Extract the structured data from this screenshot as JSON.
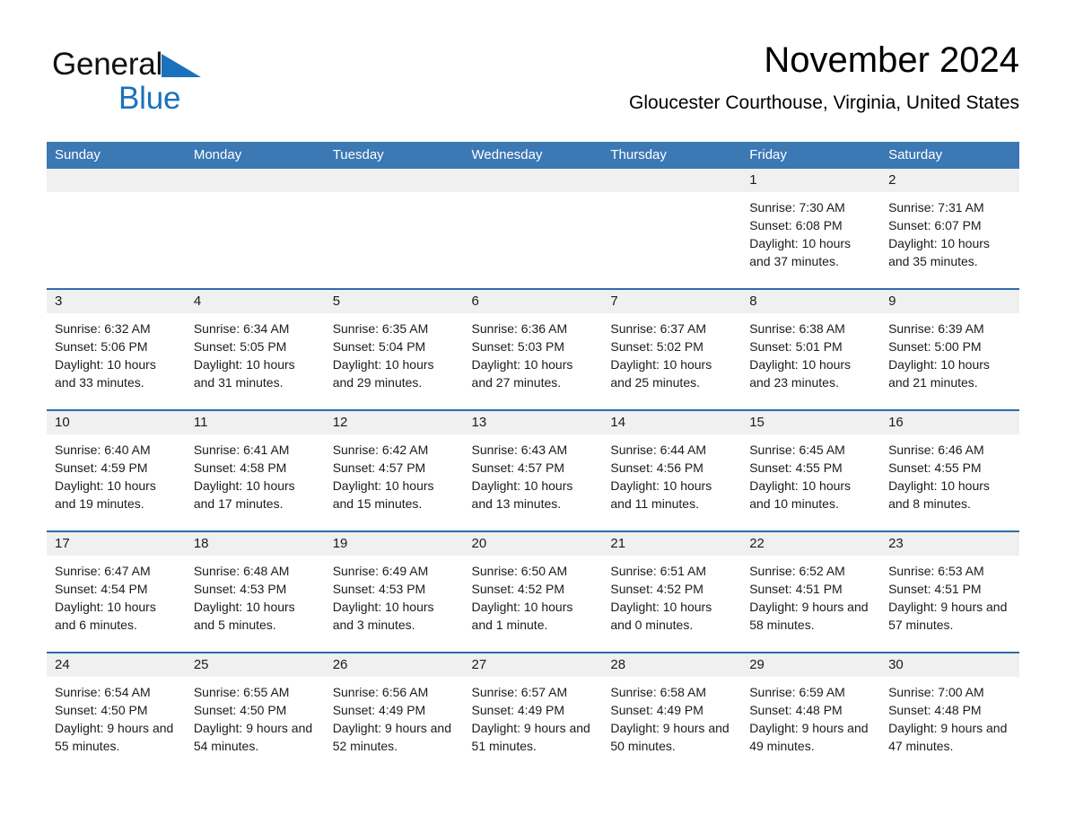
{
  "brand": {
    "name_part1": "General",
    "name_part2": "Blue",
    "logo_icon": "triangle-flag-icon",
    "accent_color": "#1a72bb"
  },
  "header": {
    "title": "November 2024",
    "subtitle": "Gloucester Courthouse, Virginia, United States"
  },
  "calendar": {
    "header_bg": "#3b78b4",
    "row_divider_color": "#2d6cab",
    "daynum_band_bg": "#f0f0f0",
    "weekday_headers": [
      "Sunday",
      "Monday",
      "Tuesday",
      "Wednesday",
      "Thursday",
      "Friday",
      "Saturday"
    ],
    "weeks": [
      [
        {
          "day": "",
          "sunrise": "",
          "sunset": "",
          "daylight": ""
        },
        {
          "day": "",
          "sunrise": "",
          "sunset": "",
          "daylight": ""
        },
        {
          "day": "",
          "sunrise": "",
          "sunset": "",
          "daylight": ""
        },
        {
          "day": "",
          "sunrise": "",
          "sunset": "",
          "daylight": ""
        },
        {
          "day": "",
          "sunrise": "",
          "sunset": "",
          "daylight": ""
        },
        {
          "day": "1",
          "sunrise": "Sunrise: 7:30 AM",
          "sunset": "Sunset: 6:08 PM",
          "daylight": "Daylight: 10 hours and 37 minutes."
        },
        {
          "day": "2",
          "sunrise": "Sunrise: 7:31 AM",
          "sunset": "Sunset: 6:07 PM",
          "daylight": "Daylight: 10 hours and 35 minutes."
        }
      ],
      [
        {
          "day": "3",
          "sunrise": "Sunrise: 6:32 AM",
          "sunset": "Sunset: 5:06 PM",
          "daylight": "Daylight: 10 hours and 33 minutes."
        },
        {
          "day": "4",
          "sunrise": "Sunrise: 6:34 AM",
          "sunset": "Sunset: 5:05 PM",
          "daylight": "Daylight: 10 hours and 31 minutes."
        },
        {
          "day": "5",
          "sunrise": "Sunrise: 6:35 AM",
          "sunset": "Sunset: 5:04 PM",
          "daylight": "Daylight: 10 hours and 29 minutes."
        },
        {
          "day": "6",
          "sunrise": "Sunrise: 6:36 AM",
          "sunset": "Sunset: 5:03 PM",
          "daylight": "Daylight: 10 hours and 27 minutes."
        },
        {
          "day": "7",
          "sunrise": "Sunrise: 6:37 AM",
          "sunset": "Sunset: 5:02 PM",
          "daylight": "Daylight: 10 hours and 25 minutes."
        },
        {
          "day": "8",
          "sunrise": "Sunrise: 6:38 AM",
          "sunset": "Sunset: 5:01 PM",
          "daylight": "Daylight: 10 hours and 23 minutes."
        },
        {
          "day": "9",
          "sunrise": "Sunrise: 6:39 AM",
          "sunset": "Sunset: 5:00 PM",
          "daylight": "Daylight: 10 hours and 21 minutes."
        }
      ],
      [
        {
          "day": "10",
          "sunrise": "Sunrise: 6:40 AM",
          "sunset": "Sunset: 4:59 PM",
          "daylight": "Daylight: 10 hours and 19 minutes."
        },
        {
          "day": "11",
          "sunrise": "Sunrise: 6:41 AM",
          "sunset": "Sunset: 4:58 PM",
          "daylight": "Daylight: 10 hours and 17 minutes."
        },
        {
          "day": "12",
          "sunrise": "Sunrise: 6:42 AM",
          "sunset": "Sunset: 4:57 PM",
          "daylight": "Daylight: 10 hours and 15 minutes."
        },
        {
          "day": "13",
          "sunrise": "Sunrise: 6:43 AM",
          "sunset": "Sunset: 4:57 PM",
          "daylight": "Daylight: 10 hours and 13 minutes."
        },
        {
          "day": "14",
          "sunrise": "Sunrise: 6:44 AM",
          "sunset": "Sunset: 4:56 PM",
          "daylight": "Daylight: 10 hours and 11 minutes."
        },
        {
          "day": "15",
          "sunrise": "Sunrise: 6:45 AM",
          "sunset": "Sunset: 4:55 PM",
          "daylight": "Daylight: 10 hours and 10 minutes."
        },
        {
          "day": "16",
          "sunrise": "Sunrise: 6:46 AM",
          "sunset": "Sunset: 4:55 PM",
          "daylight": "Daylight: 10 hours and 8 minutes."
        }
      ],
      [
        {
          "day": "17",
          "sunrise": "Sunrise: 6:47 AM",
          "sunset": "Sunset: 4:54 PM",
          "daylight": "Daylight: 10 hours and 6 minutes."
        },
        {
          "day": "18",
          "sunrise": "Sunrise: 6:48 AM",
          "sunset": "Sunset: 4:53 PM",
          "daylight": "Daylight: 10 hours and 5 minutes."
        },
        {
          "day": "19",
          "sunrise": "Sunrise: 6:49 AM",
          "sunset": "Sunset: 4:53 PM",
          "daylight": "Daylight: 10 hours and 3 minutes."
        },
        {
          "day": "20",
          "sunrise": "Sunrise: 6:50 AM",
          "sunset": "Sunset: 4:52 PM",
          "daylight": "Daylight: 10 hours and 1 minute."
        },
        {
          "day": "21",
          "sunrise": "Sunrise: 6:51 AM",
          "sunset": "Sunset: 4:52 PM",
          "daylight": "Daylight: 10 hours and 0 minutes."
        },
        {
          "day": "22",
          "sunrise": "Sunrise: 6:52 AM",
          "sunset": "Sunset: 4:51 PM",
          "daylight": "Daylight: 9 hours and 58 minutes."
        },
        {
          "day": "23",
          "sunrise": "Sunrise: 6:53 AM",
          "sunset": "Sunset: 4:51 PM",
          "daylight": "Daylight: 9 hours and 57 minutes."
        }
      ],
      [
        {
          "day": "24",
          "sunrise": "Sunrise: 6:54 AM",
          "sunset": "Sunset: 4:50 PM",
          "daylight": "Daylight: 9 hours and 55 minutes."
        },
        {
          "day": "25",
          "sunrise": "Sunrise: 6:55 AM",
          "sunset": "Sunset: 4:50 PM",
          "daylight": "Daylight: 9 hours and 54 minutes."
        },
        {
          "day": "26",
          "sunrise": "Sunrise: 6:56 AM",
          "sunset": "Sunset: 4:49 PM",
          "daylight": "Daylight: 9 hours and 52 minutes."
        },
        {
          "day": "27",
          "sunrise": "Sunrise: 6:57 AM",
          "sunset": "Sunset: 4:49 PM",
          "daylight": "Daylight: 9 hours and 51 minutes."
        },
        {
          "day": "28",
          "sunrise": "Sunrise: 6:58 AM",
          "sunset": "Sunset: 4:49 PM",
          "daylight": "Daylight: 9 hours and 50 minutes."
        },
        {
          "day": "29",
          "sunrise": "Sunrise: 6:59 AM",
          "sunset": "Sunset: 4:48 PM",
          "daylight": "Daylight: 9 hours and 49 minutes."
        },
        {
          "day": "30",
          "sunrise": "Sunrise: 7:00 AM",
          "sunset": "Sunset: 4:48 PM",
          "daylight": "Daylight: 9 hours and 47 minutes."
        }
      ]
    ]
  }
}
